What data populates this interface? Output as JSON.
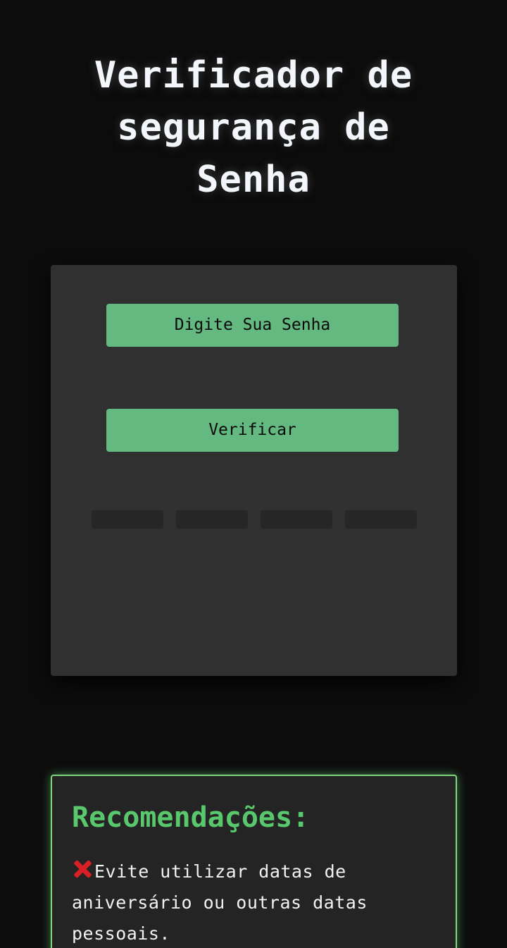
{
  "header": {
    "title": "Verificador de segurança de Senha"
  },
  "password_form": {
    "input_button_label": "Digite Sua Senha",
    "verify_button_label": "Verificar",
    "strength_meter": {
      "segments": 4,
      "filled": 0
    }
  },
  "recommendations": {
    "title": "Recomendações:",
    "items": [
      {
        "icon": "cross-mark-icon",
        "text": "Evite utilizar datas de aniversário ou outras datas pessoais."
      }
    ]
  },
  "colors": {
    "page_background": "#0c0c0c",
    "card_background": "#303030",
    "button_green": "#63b97f",
    "accent_green": "#59c86d",
    "border_green": "#7ed77f",
    "cross_red": "#d81f26"
  }
}
